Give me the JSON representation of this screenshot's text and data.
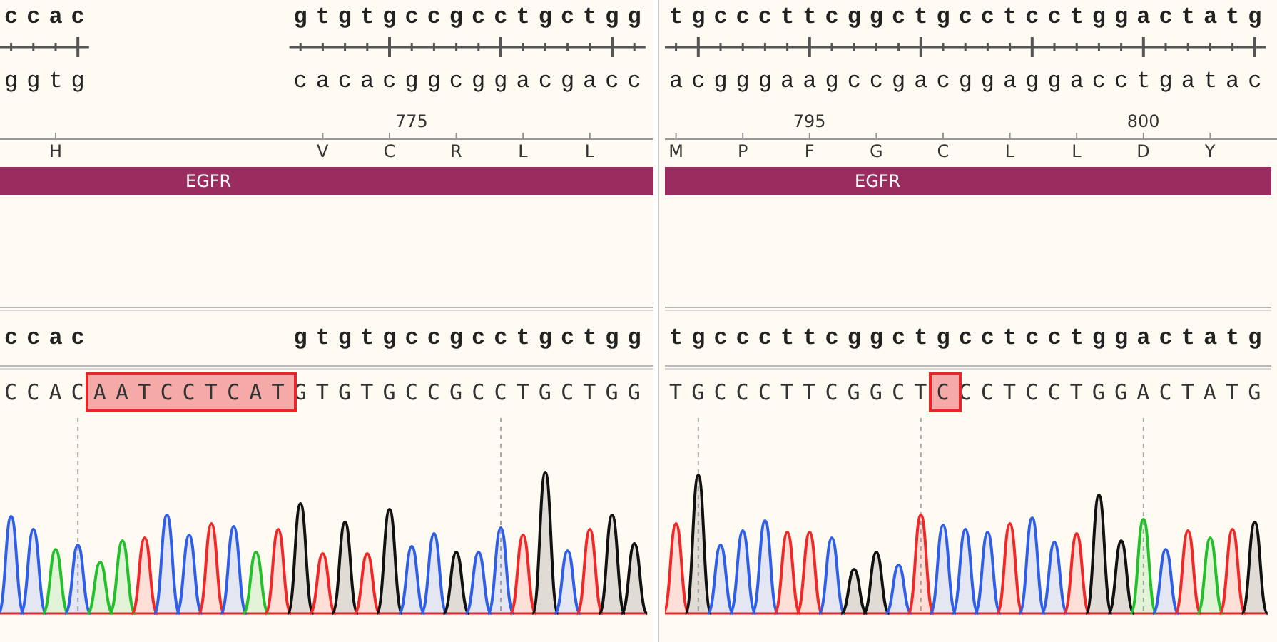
{
  "panels": [
    {
      "top_strand": "ccac         gtgtgccgcctgctgg",
      "bottom_strand": "ggtg         cacacggcggacgacc",
      "position_labels": "                 775",
      "amino_acids": "  H           V  C  R  L  L",
      "feature": {
        "label": "EGFR"
      },
      "consensus": "ccac         gtgtgccgcctgctgg",
      "read": [
        {
          "text": "CCAC",
          "highlighted": false
        },
        {
          "text": "AATCCTCAT",
          "highlighted": true
        },
        {
          "text": "GTGTGCCGCCTGCTGG",
          "highlighted": false
        }
      ]
    },
    {
      "top_strand": "tgcccttcggctgcctcctggactatg",
      "bottom_strand": "acgggaagccgacggaggacctgatac",
      "position_labels": "     795            800",
      "amino_acids": "M  P  F  G  C  L  L  D  Y",
      "feature": {
        "label": "EGFR"
      },
      "consensus": "tgcccttcggctgcctcctggactatg",
      "read": [
        {
          "text": "TGCCCTTCGGCT",
          "highlighted": false
        },
        {
          "text": "C",
          "highlighted": true
        },
        {
          "text": "CCTCCTGGACTATG",
          "highlighted": false
        }
      ]
    }
  ]
}
